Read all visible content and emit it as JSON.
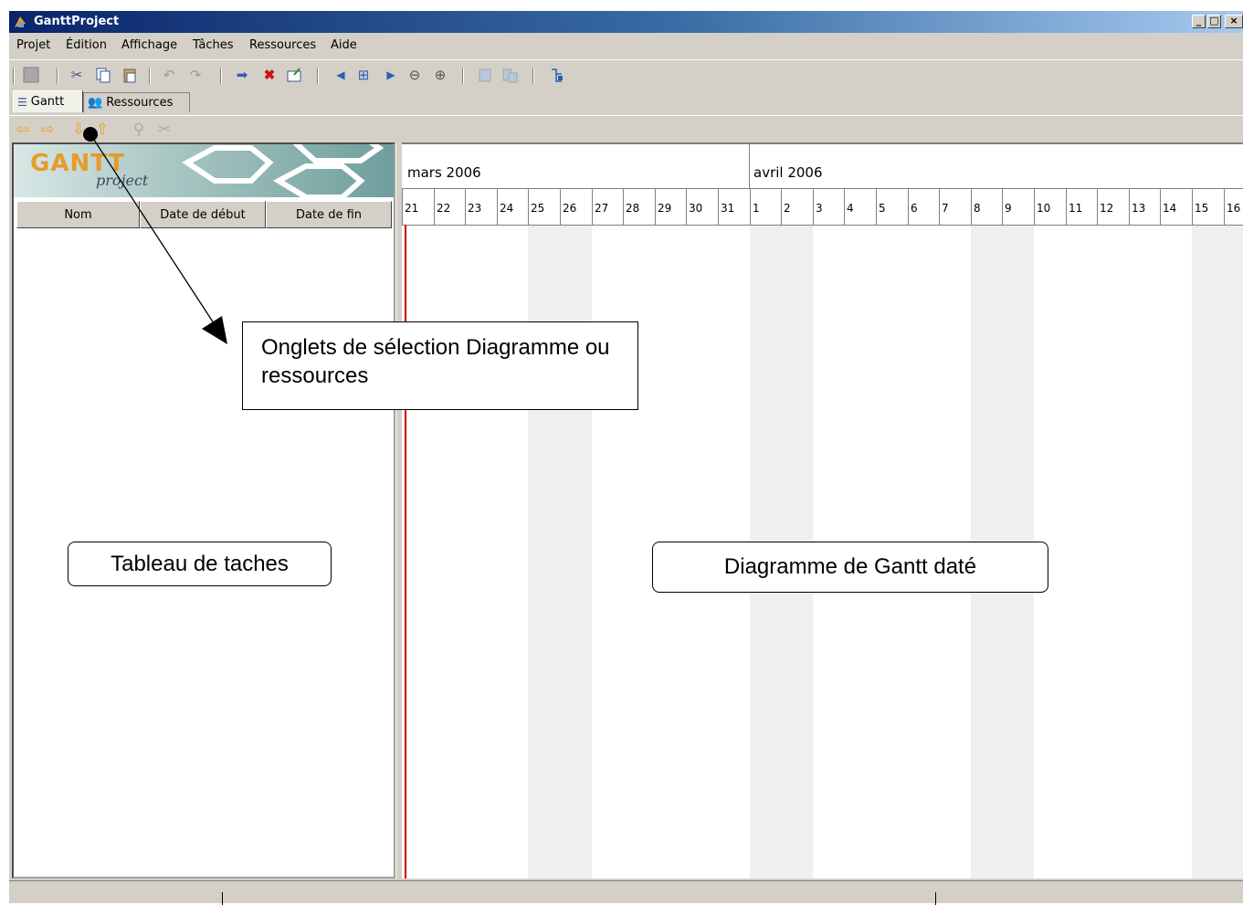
{
  "window": {
    "title": "GanttProject",
    "controls": [
      "_",
      "□",
      "×"
    ]
  },
  "menu": [
    "Projet",
    "Édition",
    "Affichage",
    "Tâches",
    "Ressources",
    "Aide"
  ],
  "toolbar": {
    "icons": [
      "save-icon",
      "cut-icon",
      "copy-icon",
      "paste-icon",
      "undo-icon",
      "redo-icon",
      "indent-icon",
      "delete-icon",
      "properties-icon",
      "scroll-left-icon",
      "fit-icon",
      "scroll-right-icon",
      "zoom-out-icon",
      "zoom-in-icon",
      "print-icon",
      "preview-icon",
      "gantt-settings-icon"
    ]
  },
  "tabs": {
    "gantt_label": "Gantt",
    "resources_label": "Ressources"
  },
  "logo": {
    "text": "GANTT",
    "sub": "project"
  },
  "task_table": {
    "columns": [
      "Nom",
      "Date de début",
      "Date de fin"
    ]
  },
  "timeline": {
    "months": [
      "mars 2006",
      "avril 2006"
    ],
    "days": [
      "21",
      "22",
      "23",
      "24",
      "25",
      "26",
      "27",
      "28",
      "29",
      "30",
      "31",
      "1",
      "2",
      "3",
      "4",
      "5",
      "6",
      "7",
      "8",
      "9",
      "10",
      "11",
      "12",
      "13",
      "14",
      "15",
      "16"
    ],
    "weekend_days": [
      "25",
      "26",
      "1",
      "2",
      "8",
      "9",
      "15",
      "16"
    ]
  },
  "annotations": {
    "tabs_callout": "Onglets de sélection Diagramme ou ressources",
    "table_callout": "Tableau de taches",
    "gantt_callout": "Diagramme de Gantt daté"
  },
  "colors": {
    "title_start": "#0a246a",
    "window_bg": "#d4d0c8",
    "weekend": "#efefef",
    "today_line": "#cc0000",
    "logo_orange": "#e69b2a"
  }
}
